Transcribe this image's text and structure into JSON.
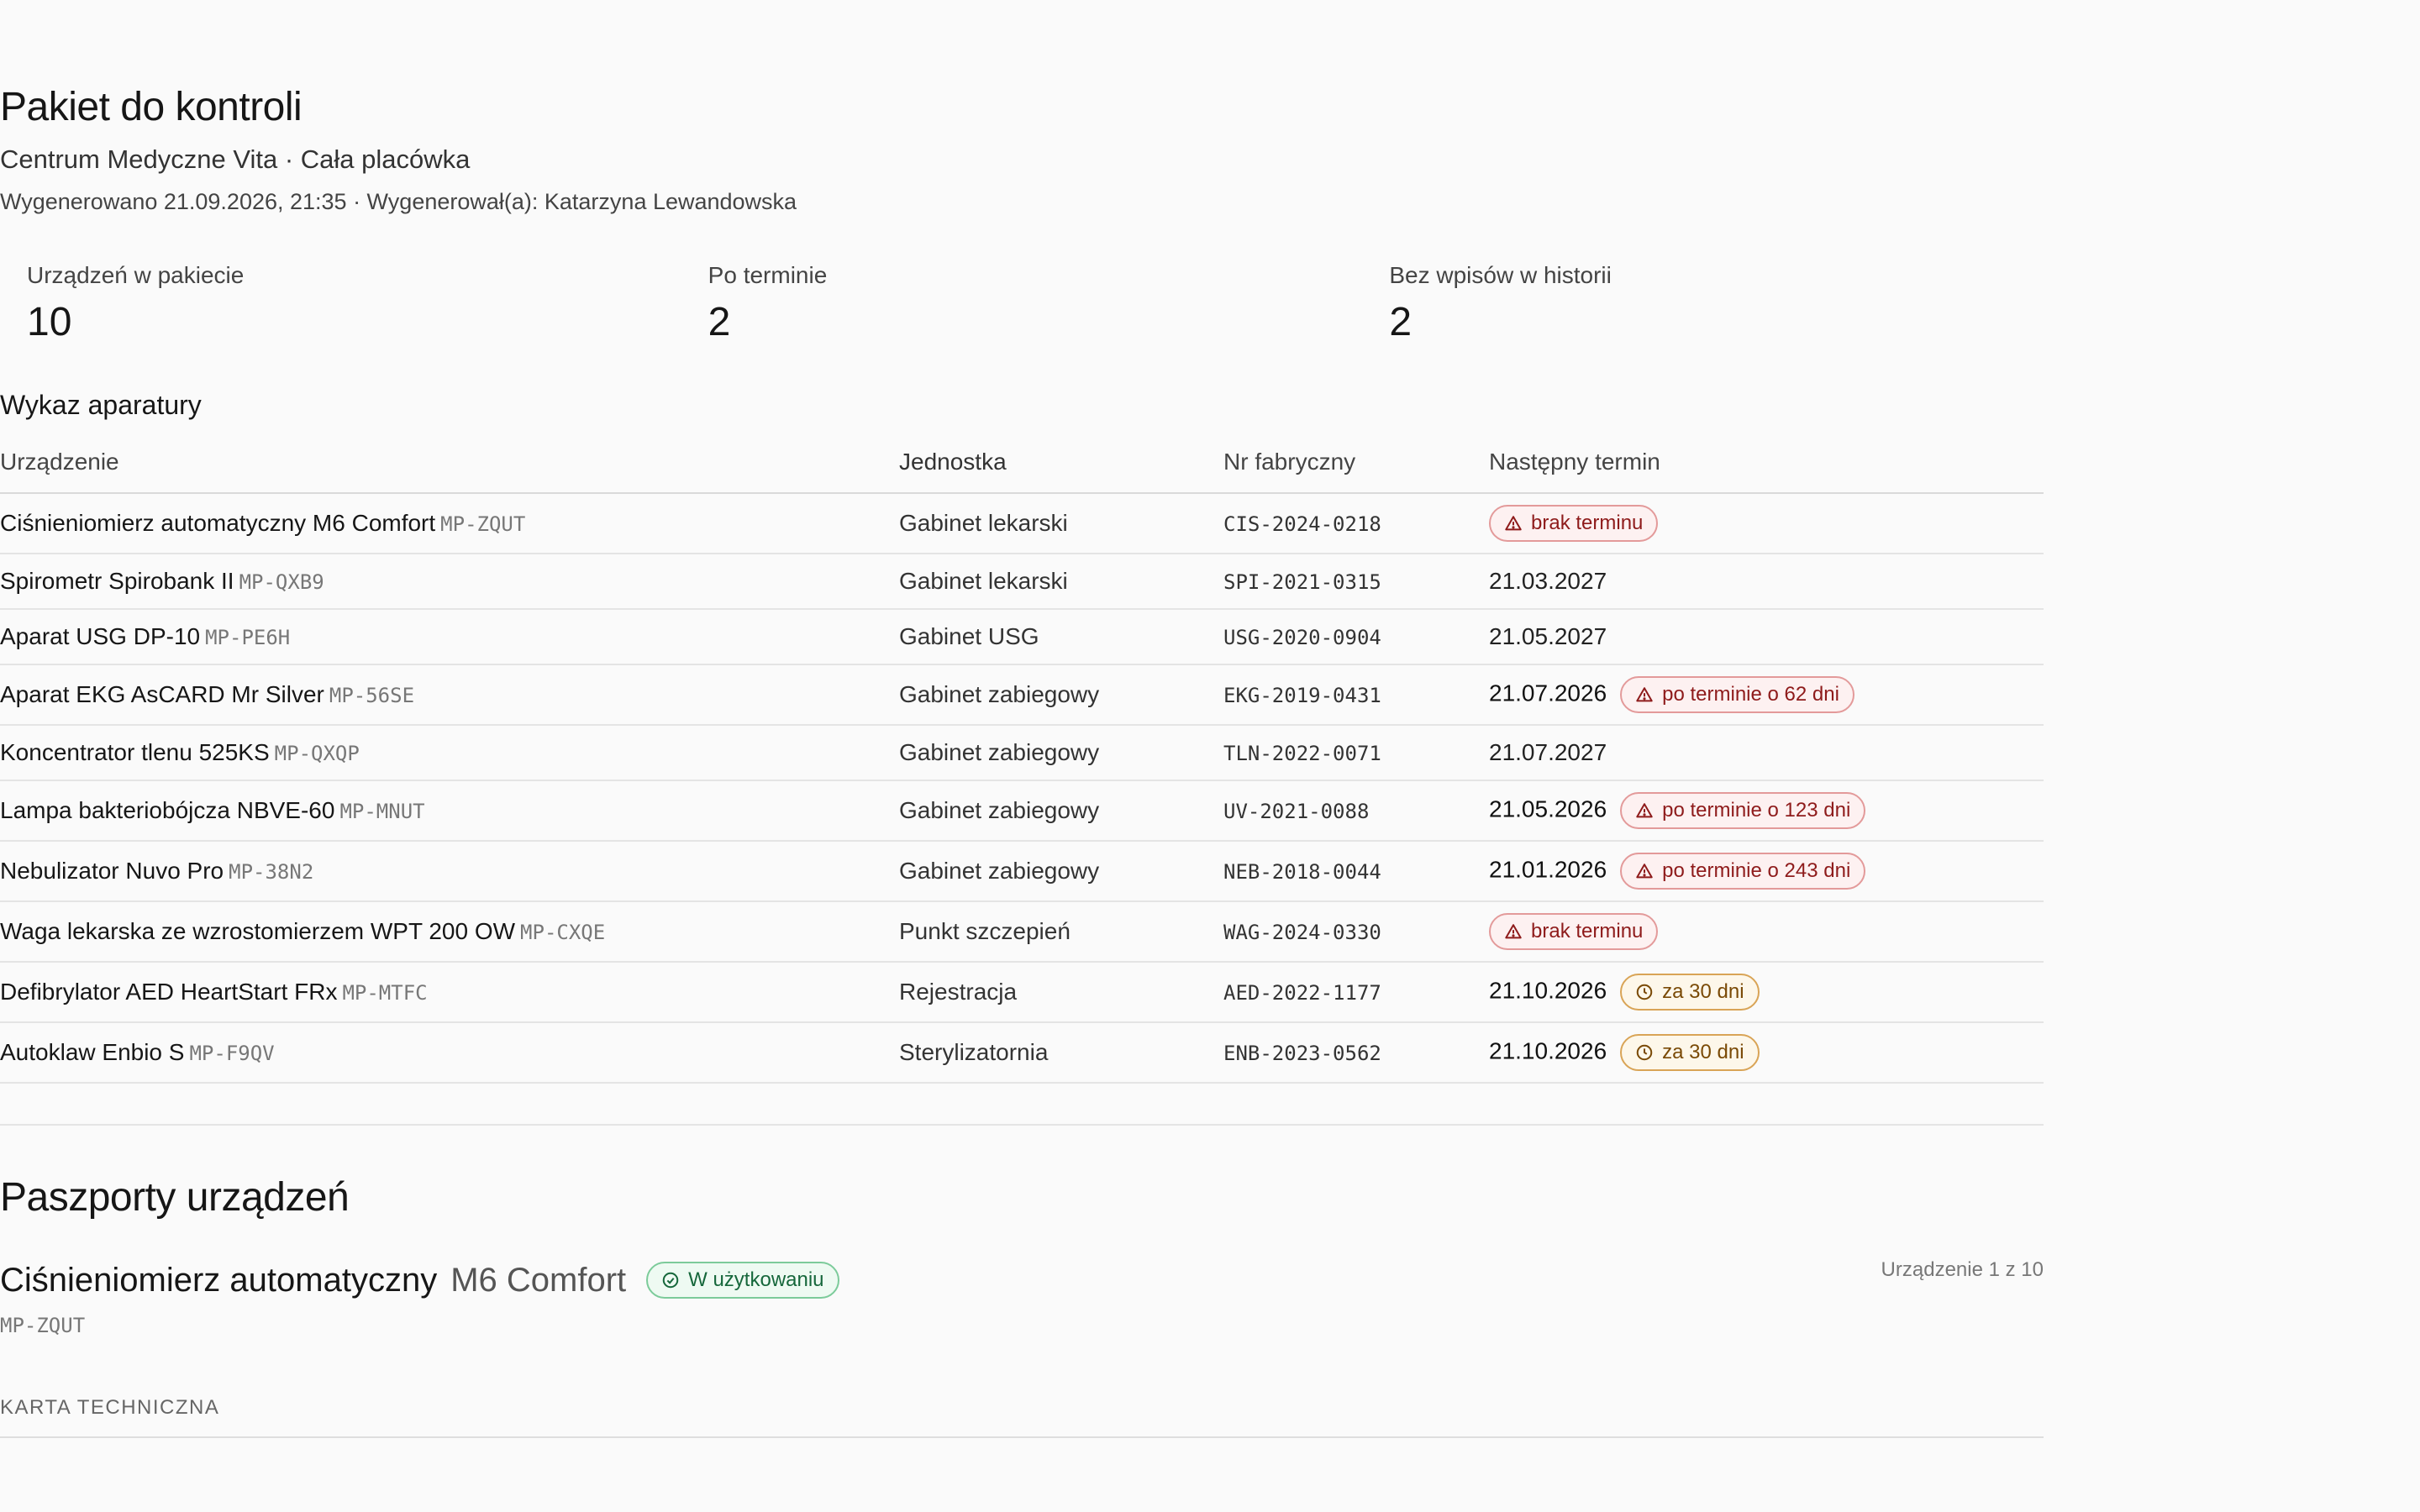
{
  "header": {
    "title": "Pakiet do kontroli",
    "subtitle": "Centrum Medyczne Vita · Cała placówka",
    "meta": "Wygenerowano 21.09.2026, 21:35 · Wygenerował(a): Katarzyna Lewandowska"
  },
  "stats": [
    {
      "label": "Urządzeń w pakiecie",
      "value": "10"
    },
    {
      "label": "Po terminie",
      "value": "2"
    },
    {
      "label": "Bez wpisów w historii",
      "value": "2"
    }
  ],
  "list": {
    "title": "Wykaz aparatury",
    "columns": [
      "Urządzenie",
      "Jednostka",
      "Nr fabryczny",
      "Następny termin"
    ],
    "rows": [
      {
        "name": "Ciśnieniomierz automatyczny M6 Comfort",
        "code": "MP-ZQUT",
        "unit": "Gabinet lekarski",
        "serial": "CIS-2024-0218",
        "date": "",
        "badge": "brak terminu",
        "badge_type": "red"
      },
      {
        "name": "Spirometr Spirobank II",
        "code": "MP-QXB9",
        "unit": "Gabinet lekarski",
        "serial": "SPI-2021-0315",
        "date": "21.03.2027",
        "badge": "",
        "badge_type": ""
      },
      {
        "name": "Aparat USG DP-10",
        "code": "MP-PE6H",
        "unit": "Gabinet USG",
        "serial": "USG-2020-0904",
        "date": "21.05.2027",
        "badge": "",
        "badge_type": ""
      },
      {
        "name": "Aparat EKG AsCARD Mr Silver",
        "code": "MP-56SE",
        "unit": "Gabinet zabiegowy",
        "serial": "EKG-2019-0431",
        "date": "21.07.2026",
        "badge": "po terminie o 62 dni",
        "badge_type": "red"
      },
      {
        "name": "Koncentrator tlenu 525KS",
        "code": "MP-QXQP",
        "unit": "Gabinet zabiegowy",
        "serial": "TLN-2022-0071",
        "date": "21.07.2027",
        "badge": "",
        "badge_type": ""
      },
      {
        "name": "Lampa bakteriobójcza NBVE-60",
        "code": "MP-MNUT",
        "unit": "Gabinet zabiegowy",
        "serial": "UV-2021-0088",
        "date": "21.05.2026",
        "badge": "po terminie o 123 dni",
        "badge_type": "red"
      },
      {
        "name": "Nebulizator Nuvo Pro",
        "code": "MP-38N2",
        "unit": "Gabinet zabiegowy",
        "serial": "NEB-2018-0044",
        "date": "21.01.2026",
        "badge": "po terminie o 243 dni",
        "badge_type": "red"
      },
      {
        "name": "Waga lekarska ze wzrostomierzem WPT 200 OW",
        "code": "MP-CXQE",
        "unit": "Punkt szczepień",
        "serial": "WAG-2024-0330",
        "date": "",
        "badge": "brak terminu",
        "badge_type": "red"
      },
      {
        "name": "Defibrylator AED HeartStart FRx",
        "code": "MP-MTFC",
        "unit": "Rejestracja",
        "serial": "AED-2022-1177",
        "date": "21.10.2026",
        "badge": "za 30 dni",
        "badge_type": "amber"
      },
      {
        "name": "Autoklaw Enbio S",
        "code": "MP-F9QV",
        "unit": "Sterylizatornia",
        "serial": "ENB-2023-0562",
        "date": "21.10.2026",
        "badge": "za 30 dni",
        "badge_type": "amber"
      }
    ]
  },
  "passports": {
    "title": "Paszporty urządzeń",
    "device_name": "Ciśnieniomierz automatyczny",
    "device_model": "M6 Comfort",
    "status": "W użytkowaniu",
    "code": "MP-ZQUT",
    "counter": "Urządzenie 1 z 10",
    "card_title": "KARTA TECHNICZNA"
  },
  "icons": {
    "warning": "warning-triangle-icon",
    "clock": "clock-icon",
    "check": "check-circle-icon"
  },
  "colors": {
    "danger": "#8e1b1b",
    "warning": "#7a4a06",
    "success": "#16673b"
  }
}
